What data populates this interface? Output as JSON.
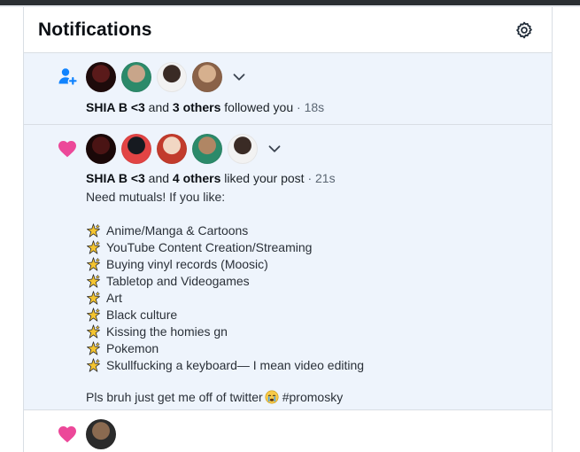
{
  "header": {
    "title": "Notifications",
    "settings_icon": "gear-icon"
  },
  "notifications": [
    {
      "type_icon": "person-plus-icon",
      "avatar_colors": [
        [
          "#5a1a1a",
          "#1e0b0b"
        ],
        [
          "#c8a58a",
          "#2c8a6a"
        ],
        [
          "#3a2b25",
          "#f2f2f2"
        ],
        [
          "#d6b08e",
          "#8a6248"
        ]
      ],
      "user": "SHIA B <3",
      "and": "and",
      "others": "3 others",
      "action": "followed you",
      "sep": "·",
      "time": "18s"
    },
    {
      "type_icon": "heart-icon",
      "avatar_colors": [
        [
          "#4a1414",
          "#1a0808"
        ],
        [
          "#161a20",
          "#e24444"
        ],
        [
          "#f1d7c3",
          "#c23b2c"
        ],
        [
          "#b08664",
          "#2c8a6a"
        ],
        [
          "#3a2b25",
          "#f2f2f2"
        ]
      ],
      "user": "SHIA B <3",
      "and": "and",
      "others": "4 others",
      "action": "liked your post",
      "sep": "·",
      "time": "21s",
      "post_intro": "Need mutuals! If you like:",
      "post_items": [
        "Anime/Manga & Cartoons",
        "YouTube Content Creation/Streaming",
        "Buying vinyl records (Moosic)",
        "Tabletop and Videogames",
        "Art",
        "Black culture",
        "Kissing the homies gn",
        "Pokemon",
        "Skullfucking a keyboard— I mean video editing"
      ],
      "post_outro_before": "Pls bruh just get me off of twitter",
      "post_outro_after": "#promosky"
    },
    {
      "type_icon": "heart-icon",
      "avatar_colors": [
        [
          "#8a6a50",
          "#2b2b2b"
        ]
      ]
    }
  ],
  "colors": {
    "heart": "#ec4899",
    "follow": "#1083fe",
    "sparkle": "#f4c430"
  }
}
